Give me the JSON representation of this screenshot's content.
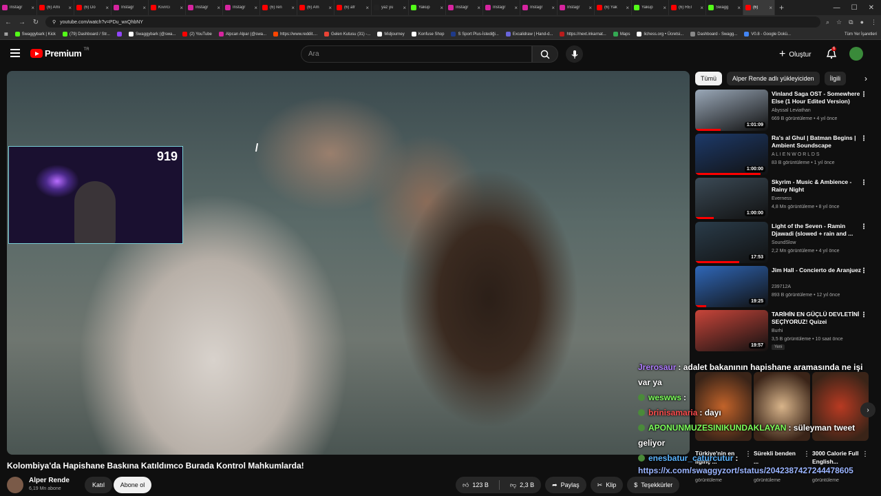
{
  "browser": {
    "tabs": [
      {
        "label": "Instagr",
        "color": "#d6249f"
      },
      {
        "label": "(6) Ami",
        "color": "#ff0000"
      },
      {
        "label": "(6) Do",
        "color": "#ff0000"
      },
      {
        "label": "Instagr",
        "color": "#d6249f"
      },
      {
        "label": "Kıvırcı",
        "color": "#ff0000"
      },
      {
        "label": "Instagr",
        "color": "#d6249f"
      },
      {
        "label": "Instagr",
        "color": "#d6249f"
      },
      {
        "label": "(6) ren",
        "color": "#ff0000"
      },
      {
        "label": "(6) Am",
        "color": "#ff0000"
      },
      {
        "label": "(6) afr",
        "color": "#ff0000"
      },
      {
        "label": "yaz yu",
        "color": "#222222"
      },
      {
        "label": "Yakup",
        "color": "#53fc18"
      },
      {
        "label": "Instagr",
        "color": "#d6249f"
      },
      {
        "label": "Instagr",
        "color": "#d6249f"
      },
      {
        "label": "Instagr",
        "color": "#d6249f"
      },
      {
        "label": "Instagr",
        "color": "#d6249f"
      },
      {
        "label": "(6) Yak",
        "color": "#ff0000"
      },
      {
        "label": "Yakup",
        "color": "#53fc18"
      },
      {
        "label": "(6) REI",
        "color": "#ff0000"
      },
      {
        "label": "Swagg",
        "color": "#53fc18"
      },
      {
        "label": "(6)",
        "color": "#ff0000",
        "active": true
      }
    ],
    "url": "youtube.com/watch?v=PDu_wxQhbNY",
    "bookmarks": [
      {
        "label": "Swaggybark | Kick",
        "color": "#53fc18"
      },
      {
        "label": "(79) Dashboard / Str...",
        "color": "#53fc18"
      },
      {
        "label": "",
        "color": "#9146ff"
      },
      {
        "label": "Swaggybark (@swa...",
        "color": "#ffffff"
      },
      {
        "label": "(2) YouTube",
        "color": "#ff0000"
      },
      {
        "label": "Alpcan Alpar (@swa...",
        "color": "#d6249f"
      },
      {
        "label": "https://www.reddit....",
        "color": "#ff4500"
      },
      {
        "label": "Gelen Kutusu (31) -...",
        "color": "#ea4335"
      },
      {
        "label": "Midjourney",
        "color": "#ffffff"
      },
      {
        "label": "Konfuse Shop",
        "color": "#ffffff"
      },
      {
        "label": "S Sport Plus-İstediği...",
        "color": "#1e3a8a"
      },
      {
        "label": "Excalidraw | Hand-d...",
        "color": "#6965db"
      },
      {
        "label": "https://next.inkarnat...",
        "color": "#b91c1c"
      },
      {
        "label": "Maps",
        "color": "#34a853"
      },
      {
        "label": "lichess.org • Ücretsi...",
        "color": "#ffffff"
      },
      {
        "label": "Dashboard - Swagg...",
        "color": "#888888"
      },
      {
        "label": "V0.8 - Google Dokü...",
        "color": "#4285f4"
      }
    ],
    "bookmarks_right": "Tüm Yer İşaretleri"
  },
  "header": {
    "logo_text": "Premium",
    "logo_sup": "TR",
    "search_placeholder": "Ara",
    "create_label": "Oluştur",
    "notification_count": "6"
  },
  "facecam": {
    "count": "919"
  },
  "video": {
    "title": "Kolombiya'da Hapishane Baskına Katıldımco Burada Kontrol Mahkumlarda!",
    "channel": "Alper Rende",
    "subscribers": "6,19 Mn abone",
    "join_label": "Katıl",
    "subscribe_label": "Abone ol",
    "likes": "123 B",
    "dislikes": "2,3 B",
    "share_label": "Paylaş",
    "clip_label": "Klip",
    "thanks_label": "Teşekkürler"
  },
  "chips": {
    "items": [
      "Tümü",
      "Alper Rende adlı yükleyiciden",
      "İlgili"
    ]
  },
  "recommendations": [
    {
      "title": "Vinland Saga OST - Somewhere Else (1 Hour Edited Version)",
      "channel": "Abyssal Leviathan",
      "meta": "669 B görüntüleme • 4 yıl önce",
      "duration": "1:01:09",
      "progress": 0.35,
      "thumb_color": "#9aa8b8",
      "badge": ""
    },
    {
      "title": "Ra's al Ghul | Batman Begins | Ambient Soundscape",
      "channel": "A L I E N W O R L D S",
      "meta": "83 B görüntüleme • 1 yıl önce",
      "duration": "1:00:00",
      "progress": 0.9,
      "thumb_color": "#1d3a6a",
      "badge": ""
    },
    {
      "title": "Skyrim - Music & Ambience - Rainy Night",
      "channel": "Everness",
      "meta": "4,8 Mn görüntüleme • 8 yıl önce",
      "duration": "1:00:00",
      "progress": 0.25,
      "thumb_color": "#3b4a56",
      "badge": ""
    },
    {
      "title": "Light of the Seven - Ramin Djawadi (slowed + rain and ...",
      "channel": "SoundSlow",
      "meta": "2,2 Mn görüntüleme • 4 yıl önce",
      "duration": "17:53",
      "progress": 0.6,
      "thumb_color": "#2a3c4a",
      "badge": ""
    },
    {
      "title": "Jim Hall - Concierto de Aranjuez",
      "channel": "239712A",
      "meta": "893 B görüntüleme • 12 yıl önce",
      "duration": "19:25",
      "progress": 0.15,
      "thumb_color": "#2f67b8",
      "badge": ""
    },
    {
      "title": "TARİHİN EN GÜÇLÜ DEVLETİNİ SEÇİYORUZ! Quizei",
      "channel": "Burhi",
      "meta": "3,5 B görüntüleme • 10 saat önce",
      "duration": "19:57",
      "progress": 0,
      "thumb_color": "#c8453a",
      "badge": "Yeni"
    }
  ],
  "shelf": [
    {
      "title": "Türkiye'nin en ilginç ...",
      "meta": "görüntüleme",
      "thumb_color": "#c2632a"
    },
    {
      "title": "Sürekli benden ...",
      "meta": "görüntüleme",
      "thumb_color": "#d8b48a"
    },
    {
      "title": "3000 Calorie Full English...",
      "meta": "görüntüleme",
      "thumb_color": "#b83a22"
    }
  ],
  "chat": {
    "lines": [
      {
        "user": "Jrerosaur",
        "user_color": "#b07cff",
        "message": ": adalet bakanının hapishane aramasında ne işi"
      },
      {
        "user": "",
        "user_color": "#ffffff",
        "message": "var ya"
      },
      {
        "user": "weswws",
        "user_color": "#7cff5a",
        "message": ":"
      },
      {
        "user": "brinisamaria",
        "user_color": "#ff4d4d",
        "message": ": dayı"
      },
      {
        "user": "APONUNMUZESINIKUNDAKLAYAN",
        "user_color": "#7cff5a",
        "message": ": süleyman tweet"
      },
      {
        "user": "",
        "user_color": "#ffffff",
        "message": "geliyor"
      },
      {
        "user": "enesbatur_caturcutur",
        "user_color": "#5ab4ff",
        "message": ":"
      }
    ],
    "link": "https://x.com/swaggyzort/status/2042387427244478605"
  }
}
